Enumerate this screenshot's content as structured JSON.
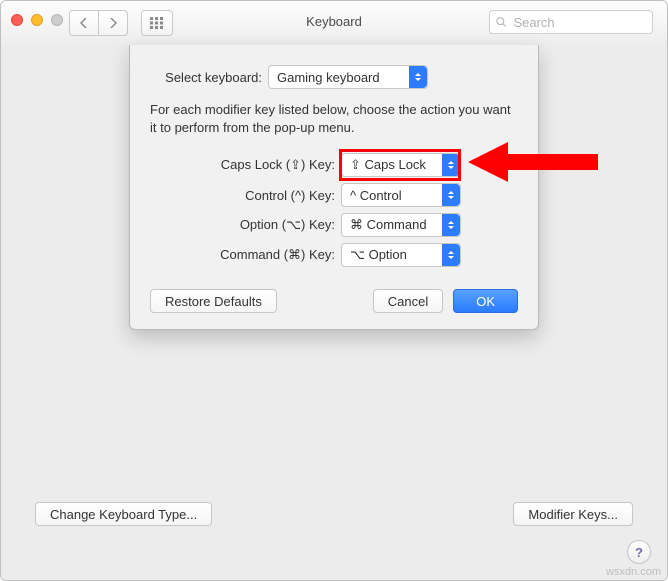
{
  "window": {
    "title": "Keyboard"
  },
  "search": {
    "placeholder": "Search"
  },
  "sheet": {
    "select_keyboard_label": "Select keyboard:",
    "keyboard_selected": "Gaming keyboard",
    "help_text": "For each modifier key listed below, choose the action you want it to perform from the pop-up menu.",
    "rows": {
      "caps": {
        "label": "Caps Lock (⇪) Key:",
        "value": "⇪ Caps Lock"
      },
      "control": {
        "label": "Control (^) Key:",
        "value": "^ Control"
      },
      "option": {
        "label": "Option (⌥) Key:",
        "value": "⌘ Command"
      },
      "command": {
        "label": "Command (⌘) Key:",
        "value": "⌥ Option"
      }
    },
    "restore": "Restore Defaults",
    "cancel": "Cancel",
    "ok": "OK"
  },
  "pane": {
    "change_type": "Change Keyboard Type...",
    "modifier_keys": "Modifier Keys..."
  },
  "watermark": "wsxdn.com"
}
